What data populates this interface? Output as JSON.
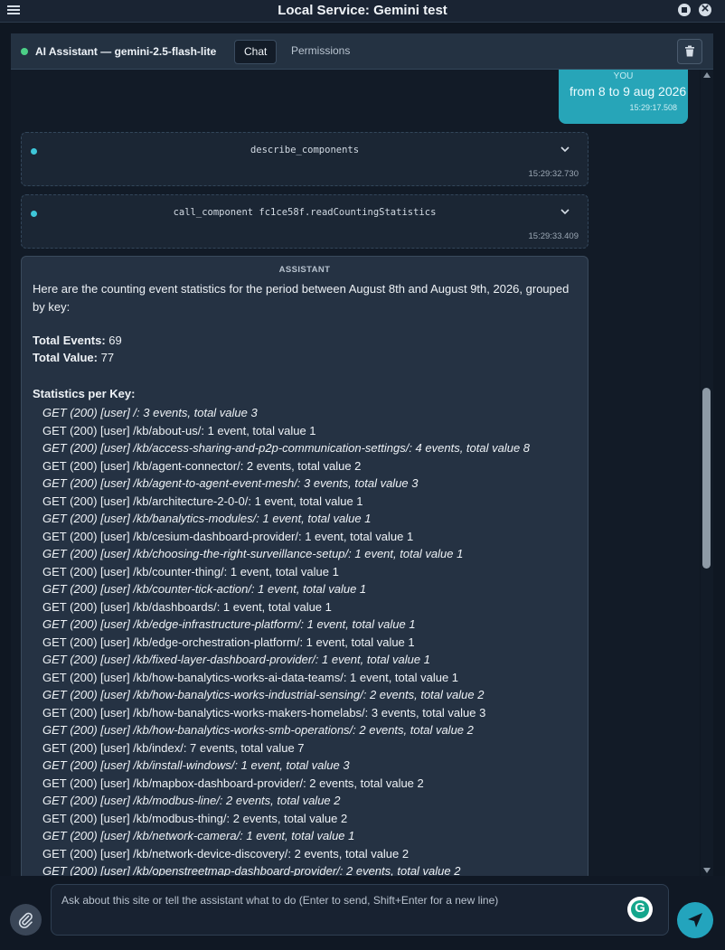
{
  "window": {
    "title": "Local Service: Gemini test"
  },
  "header": {
    "assistant_title": "AI Assistant — gemini-2.5-flash-lite",
    "tabs": [
      "Chat",
      "Permissions"
    ]
  },
  "messages": {
    "you": {
      "label": "YOU",
      "text": "from 8 to 9 aug 2026",
      "time": "15:29:17.508"
    },
    "tool_calls": [
      {
        "call": "describe_components",
        "time": "15:29:32.730"
      },
      {
        "call": "call_component fc1ce58f.readCountingStatistics",
        "time": "15:29:33.409"
      }
    ],
    "assistant": {
      "label": "ASSISTANT",
      "intro": "Here are the counting event statistics for the period between August 8th and August 9th, 2026, grouped by key:",
      "total_events_label": "Total Events:",
      "total_events_value": " 69",
      "total_value_label": "Total Value:",
      "total_value_value": " 77",
      "stats_heading": "Statistics per Key:",
      "stats": [
        "GET (200) [user] /: 3 events, total value 3",
        "GET (200) [user] /kb/about-us/: 1 event, total value 1",
        "GET (200) [user] /kb/access-sharing-and-p2p-communication-settings/: 4 events, total value 8",
        "GET (200) [user] /kb/agent-connector/: 2 events, total value 2",
        "GET (200) [user] /kb/agent-to-agent-event-mesh/: 3 events, total value 3",
        "GET (200) [user] /kb/architecture-2-0-0/: 1 event, total value 1",
        "GET (200) [user] /kb/banalytics-modules/: 1 event, total value 1",
        "GET (200) [user] /kb/cesium-dashboard-provider/: 1 event, total value 1",
        "GET (200) [user] /kb/choosing-the-right-surveillance-setup/: 1 event, total value 1",
        "GET (200) [user] /kb/counter-thing/: 1 event, total value 1",
        "GET (200) [user] /kb/counter-tick-action/: 1 event, total value 1",
        "GET (200) [user] /kb/dashboards/: 1 event, total value 1",
        "GET (200) [user] /kb/edge-infrastructure-platform/: 1 event, total value 1",
        "GET (200) [user] /kb/edge-orchestration-platform/: 1 event, total value 1",
        "GET (200) [user] /kb/fixed-layer-dashboard-provider/: 1 event, total value 1",
        "GET (200) [user] /kb/how-banalytics-works-ai-data-teams/: 1 event, total value 1",
        "GET (200) [user] /kb/how-banalytics-works-industrial-sensing/: 2 events, total value 2",
        "GET (200) [user] /kb/how-banalytics-works-makers-homelabs/: 3 events, total value 3",
        "GET (200) [user] /kb/how-banalytics-works-smb-operations/: 2 events, total value 2",
        "GET (200) [user] /kb/index/: 7 events, total value 7",
        "GET (200) [user] /kb/install-windows/: 1 event, total value 3",
        "GET (200) [user] /kb/mapbox-dashboard-provider/: 2 events, total value 2",
        "GET (200) [user] /kb/modbus-line/: 2 events, total value 2",
        "GET (200) [user] /kb/modbus-thing/: 2 events, total value 2",
        "GET (200) [user] /kb/network-camera/: 1 event, total value 1",
        "GET (200) [user] /kb/network-device-discovery/: 2 events, total value 2",
        "GET (200) [user] /kb/openstreetmap-dashboard-provider/: 2 events, total value 2"
      ]
    }
  },
  "composer": {
    "placeholder": "Ask about this site or tell the assistant what to do (Enter to send, Shift+Enter for a new line)"
  },
  "colors": {
    "accent": "#27a5b8",
    "status_ok": "#4ccf87",
    "tool_dot": "#3ec6d8"
  },
  "icons": [
    "menu-icon",
    "stop-icon",
    "close-icon",
    "trash-icon",
    "chevron-down-icon",
    "paperclip-icon",
    "grammarly-icon",
    "send-icon"
  ]
}
